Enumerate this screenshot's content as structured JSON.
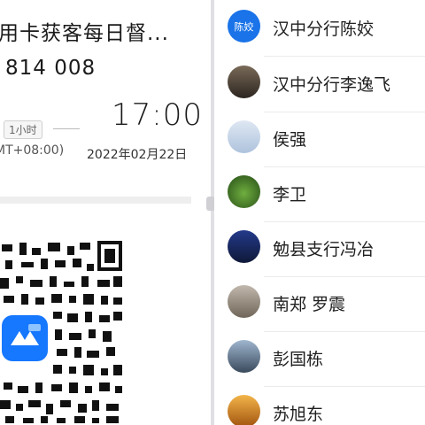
{
  "meeting": {
    "title": "用卡获客每日督...",
    "meeting_id": "814 008",
    "duration": "1小时",
    "start_time": "17:00",
    "timezone": "MT+08:00)",
    "date": "2022年02月22日"
  },
  "participants": [
    {
      "name": "汉中分行陈姣",
      "avatar_text": "陈姣",
      "avatar_color": "#1a73e8"
    },
    {
      "name": "汉中分行李逸飞",
      "avatar_color": "#4a3a2e"
    },
    {
      "name": "侯强",
      "avatar_color": "#c9d8ea"
    },
    {
      "name": "李卫",
      "avatar_color": "#3f7a2a"
    },
    {
      "name": "勉县支行冯冶",
      "avatar_color": "#1b2b66"
    },
    {
      "name": "南郑 罗震",
      "avatar_color": "#9a8e80"
    },
    {
      "name": "彭国栋",
      "avatar_color": "#6e8aa8"
    },
    {
      "name": "苏旭东",
      "avatar_color": "#e08a1e"
    }
  ],
  "colors": {
    "accent": "#1a73e8",
    "app_logo": "#1677ff"
  },
  "icons": {
    "app_logo": "tencent-meeting-logo-icon",
    "qr": "qr-code-icon"
  }
}
